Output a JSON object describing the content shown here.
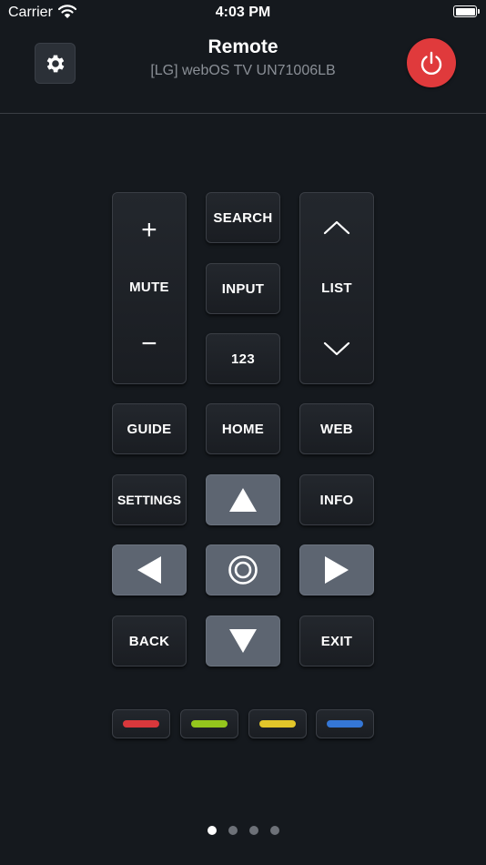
{
  "status": {
    "carrier": "Carrier",
    "time": "4:03 PM"
  },
  "header": {
    "title": "Remote",
    "subtitle": "[LG] webOS TV UN71006LB"
  },
  "buttons": {
    "volume_up": "+",
    "mute": "MUTE",
    "volume_down": "−",
    "search": "SEARCH",
    "input": "INPUT",
    "numbers": "123",
    "list": "LIST",
    "guide": "GUIDE",
    "home": "HOME",
    "web": "WEB",
    "settings": "SETTINGS",
    "info": "INFO",
    "back": "BACK",
    "exit": "EXIT"
  },
  "color_buttons": [
    "#d9383c",
    "#94c61d",
    "#e2c62a",
    "#3577d6"
  ],
  "icons": {
    "settings": "gear-icon",
    "power": "power-icon",
    "channel_up": "chevron-up-icon",
    "channel_down": "chevron-down-icon",
    "up": "triangle-up-icon",
    "down": "triangle-down-icon",
    "left": "triangle-left-icon",
    "right": "triangle-right-icon",
    "ok": "ok-ring-icon"
  },
  "pager": {
    "pages": 4,
    "active": 1
  }
}
